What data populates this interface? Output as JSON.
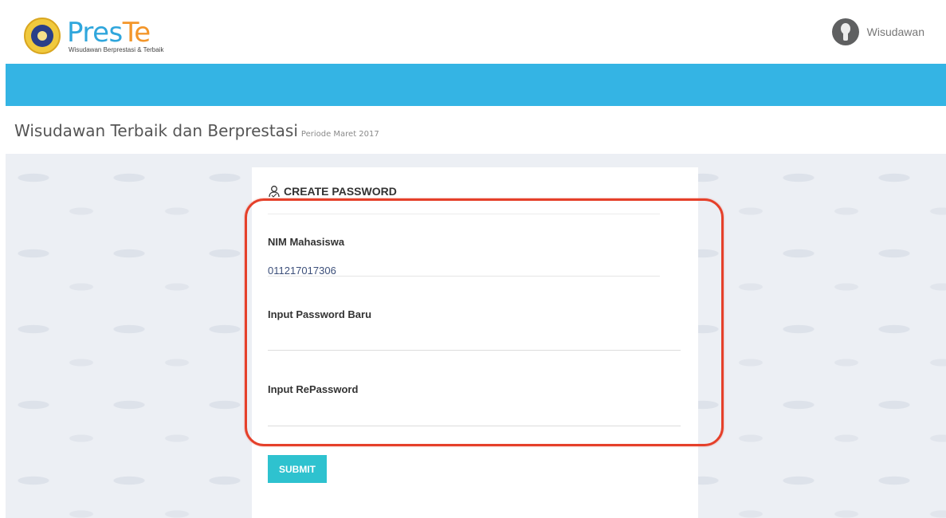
{
  "header": {
    "brand_name_part1": "Pres",
    "brand_name_part2": "Te",
    "brand_tagline": "Wisudawan Berprestasi & Terbaik",
    "user_name": "Wisudawan"
  },
  "page": {
    "title": "Wisudawan Terbaik dan Berprestasi",
    "subtitle": "Periode Maret 2017"
  },
  "form": {
    "title": "CREATE PASSWORD",
    "nim_label": "NIM Mahasiswa",
    "nim_value": "011217017306",
    "password_label": "Input Password Baru",
    "password_value": "",
    "repassword_label": "Input RePassword",
    "repassword_value": "",
    "submit_label": "SUBMIT"
  },
  "colors": {
    "accent_blue": "#34b4e4",
    "brand_orange": "#f3962a",
    "submit_teal": "#2ec2cf",
    "highlight_red": "#e5402a"
  },
  "icons": {
    "form_title_icon": "user-outline-icon",
    "avatar": "user-avatar-icon",
    "logo": "university-seal-icon"
  }
}
